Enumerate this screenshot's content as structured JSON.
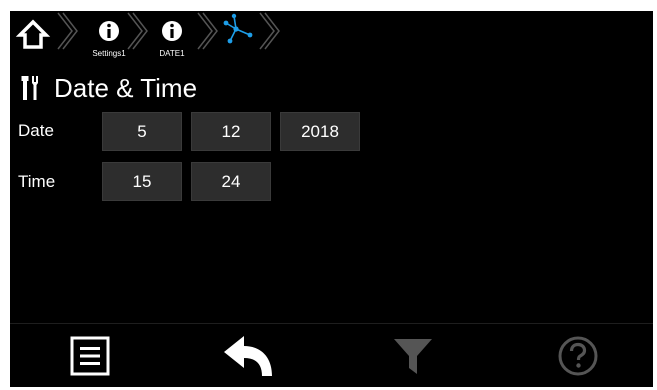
{
  "breadcrumb": {
    "home_icon": "home-icon",
    "items": [
      {
        "label": "Settings1",
        "icon": "info-icon"
      },
      {
        "label": "DATE1",
        "icon": "info-icon"
      }
    ],
    "current_icon": "network-icon",
    "accent": "#1e9ee8"
  },
  "page": {
    "title": "Date & Time",
    "icon": "wrench-screwdriver-icon"
  },
  "date": {
    "label": "Date",
    "day": "5",
    "month": "12",
    "year": "2018"
  },
  "time": {
    "label": "Time",
    "hour": "15",
    "minute": "24"
  },
  "bottom_bar": {
    "menu_icon": "menu-icon",
    "back_icon": "back-arrow-icon",
    "filter_icon": "filter-icon",
    "help_icon": "help-icon"
  }
}
